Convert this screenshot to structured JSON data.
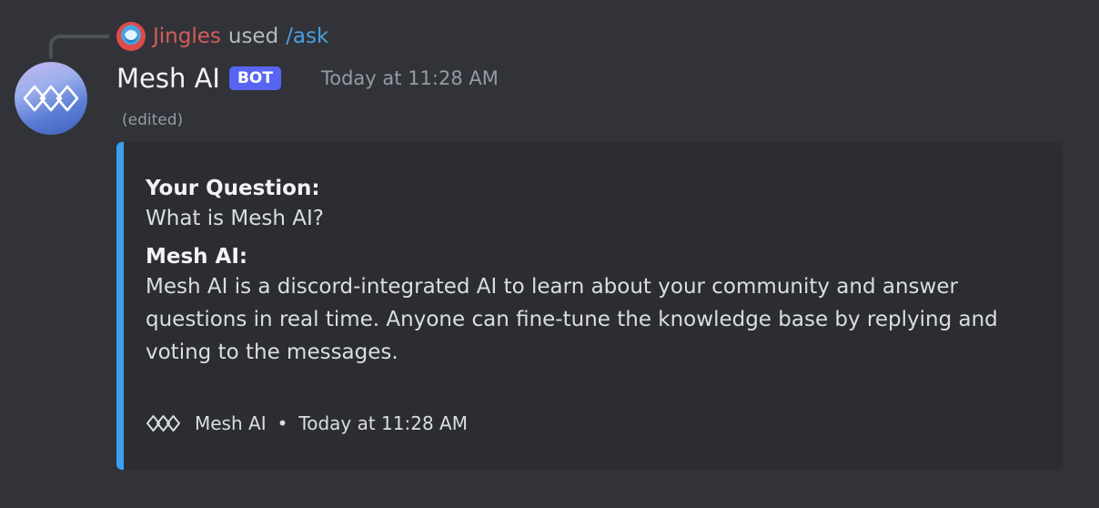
{
  "reply": {
    "user": "Jingles",
    "action": "used",
    "command": "/ask"
  },
  "message": {
    "author": "Mesh AI",
    "bot_tag": "BOT",
    "timestamp": "Today at 11:28 AM",
    "edited": "(edited)"
  },
  "embed": {
    "accent_color": "#3ba0f0",
    "fields": [
      {
        "name": "Your Question:",
        "value": "What is Mesh AI?"
      },
      {
        "name": "Mesh AI:",
        "value": "Mesh AI is a discord-integrated AI to learn about your community and answer questions in real time. Anyone can fine-tune the knowledge base by replying and voting to the messages."
      }
    ],
    "footer": {
      "text": "Mesh AI",
      "separator": "•",
      "timestamp": "Today at 11:28 AM",
      "icon": "mesh-logo-icon"
    }
  },
  "colors": {
    "background": "#313338",
    "embed_background": "#2b2d31",
    "bot_tag": "#5865f2",
    "reply_user": "#d35c5c",
    "command_link": "#4a9fe0"
  }
}
